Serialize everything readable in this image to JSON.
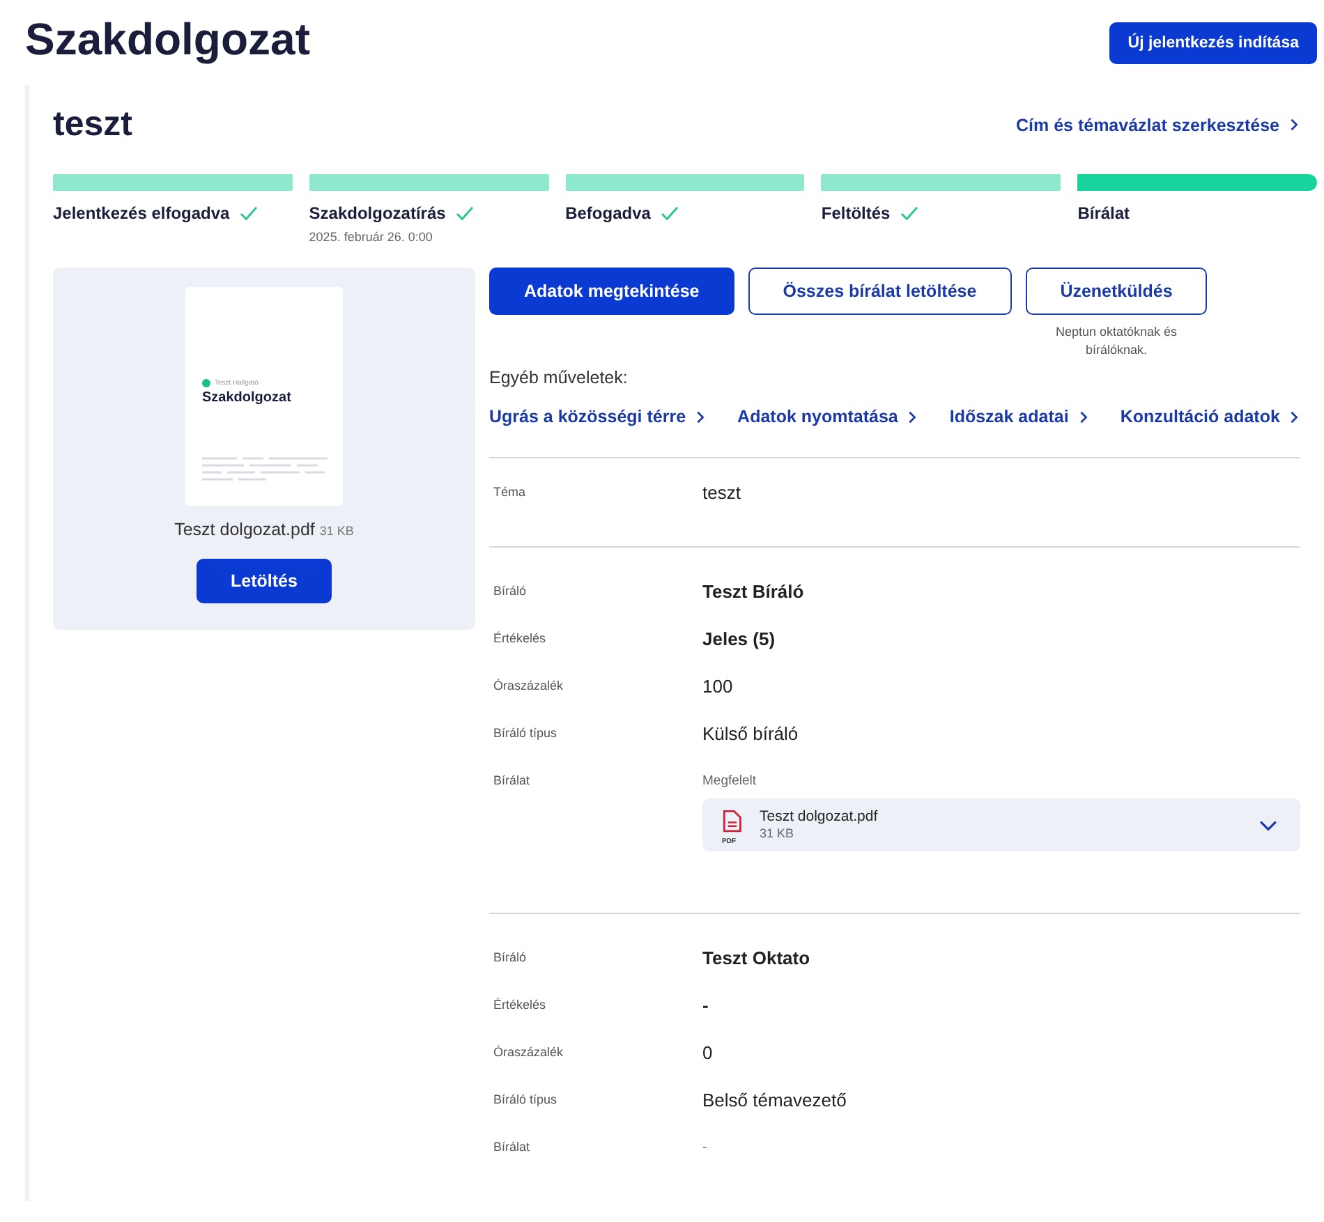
{
  "page_title": "Szakdolgozat",
  "new_button": "Új jelentkezés indítása",
  "card": {
    "title": "teszt",
    "edit_link": "Cím és témavázlat szerkesztése",
    "steps": [
      {
        "label": "Jelentkezés elfogadva",
        "done": true,
        "current": false
      },
      {
        "label": "Szakdolgozatírás",
        "done": true,
        "current": false,
        "date": "2025. február 26. 0:00"
      },
      {
        "label": "Befogadva",
        "done": true,
        "current": false
      },
      {
        "label": "Feltöltés",
        "done": true,
        "current": false
      },
      {
        "label": "Bírálat",
        "done": false,
        "current": true
      }
    ],
    "document": {
      "author": "Teszt Hallgató",
      "heading": "Szakdolgozat",
      "file_name": "Teszt dolgozat.pdf",
      "size": "31 KB",
      "download": "Letöltés"
    },
    "actions": [
      {
        "label": "Adatok megtekintése",
        "kind": "primary"
      },
      {
        "label": "Összes bírálat letöltése",
        "kind": "outline"
      },
      {
        "label": "Üzenetküldés",
        "kind": "outline",
        "note": "Neptun oktatóknak és bírálóknak."
      }
    ],
    "other_label": "Egyéb műveletek:",
    "other_links": [
      "Ugrás a közösségi térre",
      "Adatok nyomtatása",
      "Időszak adatai",
      "Konzultáció adatok"
    ],
    "topic": {
      "label": "Téma",
      "value": "teszt"
    },
    "reviews": [
      {
        "fields": [
          {
            "label": "Bíráló",
            "value": "Teszt Bíráló",
            "kind": "strong"
          },
          {
            "label": "Értékelés",
            "value": "Jeles (5)",
            "kind": "strong"
          },
          {
            "label": "Óraszázalék",
            "value": "100",
            "kind": "plain"
          },
          {
            "label": "Bíráló típus",
            "value": "Külső bíráló",
            "kind": "plain"
          },
          {
            "label": "Bírálat",
            "value": "Megfelelt",
            "kind": "muted"
          }
        ],
        "attachment": {
          "file_name": "Teszt dolgozat.pdf",
          "size": "31 KB",
          "badge": "PDF"
        }
      },
      {
        "fields": [
          {
            "label": "Bíráló",
            "value": "Teszt Oktato",
            "kind": "strong"
          },
          {
            "label": "Értékelés",
            "value": "-",
            "kind": "strong"
          },
          {
            "label": "Óraszázalék",
            "value": "0",
            "kind": "plain"
          },
          {
            "label": "Bíráló típus",
            "value": "Belső témavezető",
            "kind": "plain"
          },
          {
            "label": "Bírálat",
            "value": "-",
            "kind": "muted"
          }
        ]
      }
    ]
  }
}
